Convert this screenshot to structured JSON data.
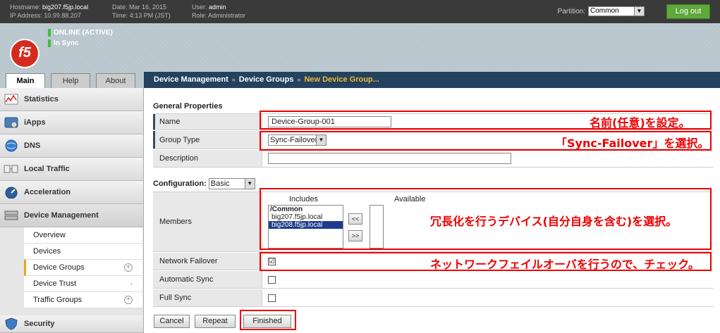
{
  "topbar": {
    "hostname_label": "Hostname:",
    "hostname": "big207.f5jp.local",
    "ip_label": "IP Address:",
    "ip": "10.99.88.207",
    "date_label": "Date:",
    "date": "Mar 16, 2015",
    "time_label": "Time:",
    "time": "4:13 PM (JST)",
    "user_label": "User:",
    "user": "admin",
    "role_label": "Role:",
    "role": "Administrator",
    "partition_label": "Partition:",
    "partition_value": "Common",
    "logout_label": "Log out"
  },
  "banner": {
    "logo": "f5",
    "status_online": "ONLINE (ACTIVE)",
    "status_sync": "In Sync"
  },
  "tabs": [
    "Main",
    "Help",
    "About"
  ],
  "breadcrumb": [
    "Device Management",
    "Device Groups",
    "New Device Group..."
  ],
  "sidebar": {
    "items": [
      {
        "label": "Statistics",
        "icon": "statistics-icon"
      },
      {
        "label": "iApps",
        "icon": "iapps-icon"
      },
      {
        "label": "DNS",
        "icon": "dns-icon"
      },
      {
        "label": "Local Traffic",
        "icon": "local-traffic-icon"
      },
      {
        "label": "Acceleration",
        "icon": "acceleration-icon"
      },
      {
        "label": "Device Management",
        "icon": "device-management-icon"
      },
      {
        "label": "Security",
        "icon": "security-icon"
      }
    ],
    "sub_items": [
      "Overview",
      "Devices",
      "Device Groups",
      "Device Trust",
      "Traffic Groups"
    ]
  },
  "form": {
    "general_title": "General Properties",
    "name_label": "Name",
    "name_value": "Device-Group-001",
    "group_type_label": "Group Type",
    "group_type_value": "Sync-Failover",
    "description_label": "Description",
    "description_value": "",
    "configuration_label": "Configuration:",
    "configuration_value": "Basic",
    "members_label": "Members",
    "includes_label": "Includes",
    "available_label": "Available",
    "includes_items": [
      "/Common",
      "big207.f5jp.local",
      "big208.f5jp.local"
    ],
    "move_left": "<<",
    "move_right": ">>",
    "network_failover_label": "Network Failover",
    "network_failover_checked": "☑",
    "automatic_sync_label": "Automatic Sync",
    "full_sync_label": "Full Sync"
  },
  "buttons": {
    "cancel": "Cancel",
    "repeat": "Repeat",
    "finished": "Finished"
  },
  "annotations": {
    "name": "名前(任意)を設定。",
    "group_type": "「Sync-Failover」を選択。",
    "members": "冗長化を行うデバイス(自分自身を含む)を選択。",
    "network_failover": "ネットワークフェイルオーバを行うので、チェック。"
  },
  "colors": {
    "annotation_red": "#e00000",
    "breadcrumb_current": "#f0b73a",
    "nav_bg": "#24425e",
    "logout_green": "#5fa83b"
  }
}
